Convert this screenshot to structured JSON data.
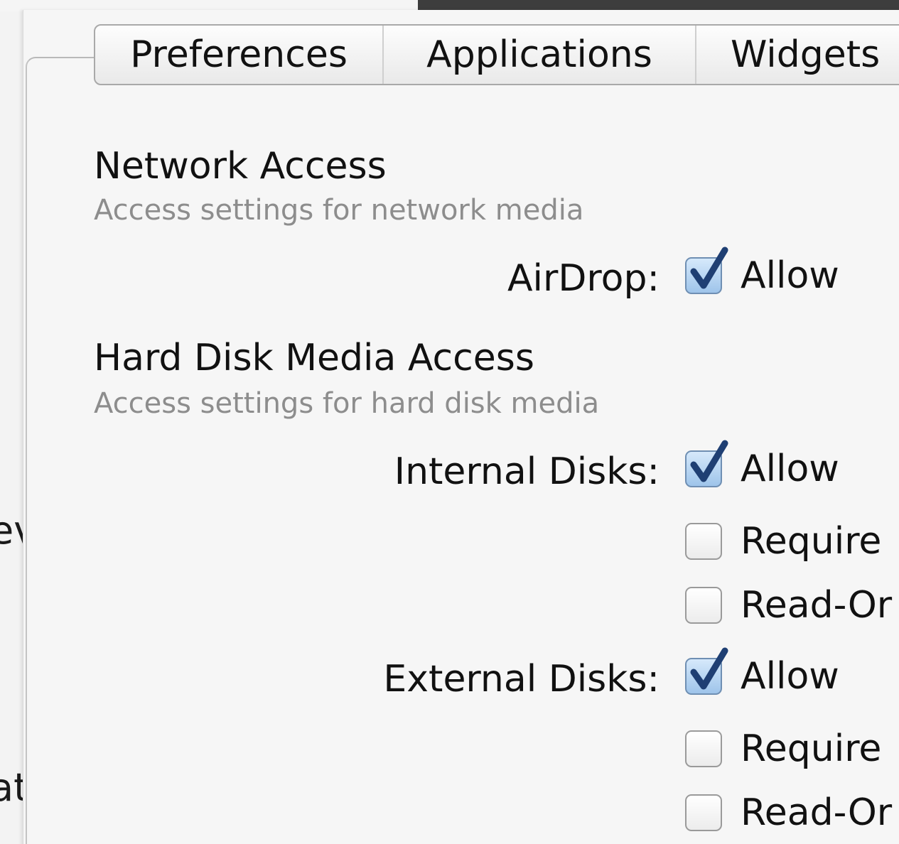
{
  "background_window": {
    "fragment_1": "ev",
    "fragment_2": "at"
  },
  "tabs": [
    {
      "label": "Preferences"
    },
    {
      "label": "Applications"
    },
    {
      "label": "Widgets"
    }
  ],
  "network_section": {
    "title": "Network Access",
    "subtitle": "Access settings for network media",
    "rows": [
      {
        "label": "AirDrop:",
        "option": "Allow",
        "checked": true
      }
    ]
  },
  "hard_disk_section": {
    "title": "Hard Disk Media Access",
    "subtitle": "Access settings for hard disk media",
    "internal": {
      "label": "Internal Disks:",
      "options": [
        {
          "text": "Allow",
          "checked": true
        },
        {
          "text": "Require",
          "checked": false
        },
        {
          "text": "Read-Or",
          "checked": false
        }
      ]
    },
    "external": {
      "label": "External Disks:",
      "options": [
        {
          "text": "Allow",
          "checked": true
        },
        {
          "text": "Require",
          "checked": false
        },
        {
          "text": "Read-Or",
          "checked": false
        }
      ]
    }
  },
  "colors": {
    "accent_check": "#1f3f73",
    "checked_fill": "#a9cbee",
    "subtitle_gray": "#8d8d8d"
  }
}
